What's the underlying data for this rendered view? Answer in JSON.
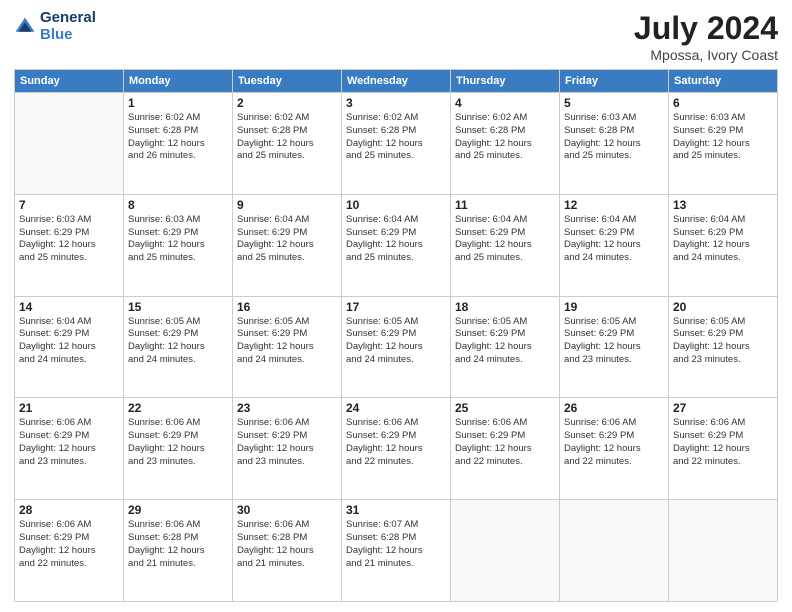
{
  "header": {
    "logo_line1": "General",
    "logo_line2": "Blue",
    "title": "July 2024",
    "subtitle": "Mpossa, Ivory Coast"
  },
  "days_of_week": [
    "Sunday",
    "Monday",
    "Tuesday",
    "Wednesday",
    "Thursday",
    "Friday",
    "Saturday"
  ],
  "weeks": [
    [
      {
        "day": "",
        "info": ""
      },
      {
        "day": "1",
        "info": "Sunrise: 6:02 AM\nSunset: 6:28 PM\nDaylight: 12 hours\nand 26 minutes."
      },
      {
        "day": "2",
        "info": "Sunrise: 6:02 AM\nSunset: 6:28 PM\nDaylight: 12 hours\nand 25 minutes."
      },
      {
        "day": "3",
        "info": "Sunrise: 6:02 AM\nSunset: 6:28 PM\nDaylight: 12 hours\nand 25 minutes."
      },
      {
        "day": "4",
        "info": "Sunrise: 6:02 AM\nSunset: 6:28 PM\nDaylight: 12 hours\nand 25 minutes."
      },
      {
        "day": "5",
        "info": "Sunrise: 6:03 AM\nSunset: 6:28 PM\nDaylight: 12 hours\nand 25 minutes."
      },
      {
        "day": "6",
        "info": "Sunrise: 6:03 AM\nSunset: 6:29 PM\nDaylight: 12 hours\nand 25 minutes."
      }
    ],
    [
      {
        "day": "7",
        "info": "Sunrise: 6:03 AM\nSunset: 6:29 PM\nDaylight: 12 hours\nand 25 minutes."
      },
      {
        "day": "8",
        "info": "Sunrise: 6:03 AM\nSunset: 6:29 PM\nDaylight: 12 hours\nand 25 minutes."
      },
      {
        "day": "9",
        "info": "Sunrise: 6:04 AM\nSunset: 6:29 PM\nDaylight: 12 hours\nand 25 minutes."
      },
      {
        "day": "10",
        "info": "Sunrise: 6:04 AM\nSunset: 6:29 PM\nDaylight: 12 hours\nand 25 minutes."
      },
      {
        "day": "11",
        "info": "Sunrise: 6:04 AM\nSunset: 6:29 PM\nDaylight: 12 hours\nand 25 minutes."
      },
      {
        "day": "12",
        "info": "Sunrise: 6:04 AM\nSunset: 6:29 PM\nDaylight: 12 hours\nand 24 minutes."
      },
      {
        "day": "13",
        "info": "Sunrise: 6:04 AM\nSunset: 6:29 PM\nDaylight: 12 hours\nand 24 minutes."
      }
    ],
    [
      {
        "day": "14",
        "info": "Sunrise: 6:04 AM\nSunset: 6:29 PM\nDaylight: 12 hours\nand 24 minutes."
      },
      {
        "day": "15",
        "info": "Sunrise: 6:05 AM\nSunset: 6:29 PM\nDaylight: 12 hours\nand 24 minutes."
      },
      {
        "day": "16",
        "info": "Sunrise: 6:05 AM\nSunset: 6:29 PM\nDaylight: 12 hours\nand 24 minutes."
      },
      {
        "day": "17",
        "info": "Sunrise: 6:05 AM\nSunset: 6:29 PM\nDaylight: 12 hours\nand 24 minutes."
      },
      {
        "day": "18",
        "info": "Sunrise: 6:05 AM\nSunset: 6:29 PM\nDaylight: 12 hours\nand 24 minutes."
      },
      {
        "day": "19",
        "info": "Sunrise: 6:05 AM\nSunset: 6:29 PM\nDaylight: 12 hours\nand 23 minutes."
      },
      {
        "day": "20",
        "info": "Sunrise: 6:05 AM\nSunset: 6:29 PM\nDaylight: 12 hours\nand 23 minutes."
      }
    ],
    [
      {
        "day": "21",
        "info": "Sunrise: 6:06 AM\nSunset: 6:29 PM\nDaylight: 12 hours\nand 23 minutes."
      },
      {
        "day": "22",
        "info": "Sunrise: 6:06 AM\nSunset: 6:29 PM\nDaylight: 12 hours\nand 23 minutes."
      },
      {
        "day": "23",
        "info": "Sunrise: 6:06 AM\nSunset: 6:29 PM\nDaylight: 12 hours\nand 23 minutes."
      },
      {
        "day": "24",
        "info": "Sunrise: 6:06 AM\nSunset: 6:29 PM\nDaylight: 12 hours\nand 22 minutes."
      },
      {
        "day": "25",
        "info": "Sunrise: 6:06 AM\nSunset: 6:29 PM\nDaylight: 12 hours\nand 22 minutes."
      },
      {
        "day": "26",
        "info": "Sunrise: 6:06 AM\nSunset: 6:29 PM\nDaylight: 12 hours\nand 22 minutes."
      },
      {
        "day": "27",
        "info": "Sunrise: 6:06 AM\nSunset: 6:29 PM\nDaylight: 12 hours\nand 22 minutes."
      }
    ],
    [
      {
        "day": "28",
        "info": "Sunrise: 6:06 AM\nSunset: 6:29 PM\nDaylight: 12 hours\nand 22 minutes."
      },
      {
        "day": "29",
        "info": "Sunrise: 6:06 AM\nSunset: 6:28 PM\nDaylight: 12 hours\nand 21 minutes."
      },
      {
        "day": "30",
        "info": "Sunrise: 6:06 AM\nSunset: 6:28 PM\nDaylight: 12 hours\nand 21 minutes."
      },
      {
        "day": "31",
        "info": "Sunrise: 6:07 AM\nSunset: 6:28 PM\nDaylight: 12 hours\nand 21 minutes."
      },
      {
        "day": "",
        "info": ""
      },
      {
        "day": "",
        "info": ""
      },
      {
        "day": "",
        "info": ""
      }
    ]
  ]
}
